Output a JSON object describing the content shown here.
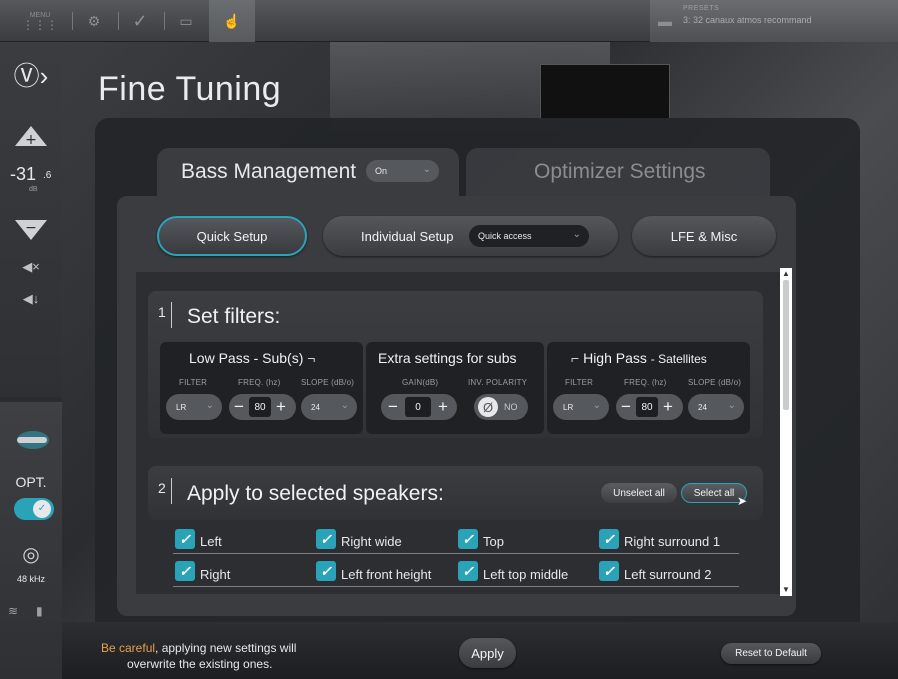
{
  "topbar": {
    "menu_label": "MENU",
    "presets_label": "PRESETS",
    "presets_value": "3: 32 canaux atmos recommand"
  },
  "sidebar": {
    "volume_value": "-31",
    "volume_decimal": ".6",
    "volume_unit": "dB",
    "opt_label": "OPT.",
    "sample_rate": "48 kHz"
  },
  "page": {
    "title": "Fine Tuning"
  },
  "tabs": [
    {
      "label": "Bass Management",
      "combo_value": "On"
    },
    {
      "label": "Optimizer Settings"
    }
  ],
  "subtabs": {
    "quick_setup": "Quick Setup",
    "individual_setup": "Individual Setup",
    "individual_combo": "Quick access",
    "lfe_misc": "LFE & Misc"
  },
  "section1": {
    "number": "1",
    "title": "Set filters:",
    "low_pass": {
      "title": "Low Pass",
      "subtitle": "- Sub(s)",
      "filter_header": "FILTER",
      "freq_header": "FREQ. (hz)",
      "slope_header": "SLOPE (dB/o)",
      "filter_value": "LR",
      "freq_value": "80",
      "slope_value": "24"
    },
    "extra": {
      "title": "Extra settings for subs",
      "gain_header": "GAIN(dB)",
      "polarity_header": "INV. POLARITY",
      "gain_value": "0",
      "polarity_value": "NO",
      "polarity_symbol": "Ø"
    },
    "high_pass": {
      "title": "High Pass",
      "subtitle": "- Satellites",
      "filter_header": "FILTER",
      "freq_header": "FREQ. (hz)",
      "slope_header": "SLOPE (dB/o)",
      "filter_value": "LR",
      "freq_value": "80",
      "slope_value": "24"
    }
  },
  "section2": {
    "number": "2",
    "title": "Apply to selected speakers:",
    "unselect_all": "Unselect all",
    "select_all": "Select all",
    "speakers_row1": [
      "Left",
      "Right wide",
      "Top",
      "Right surround 1"
    ],
    "speakers_row2": [
      "Right",
      "Left front height",
      "Left top middle",
      "Left surround 2"
    ]
  },
  "bottom": {
    "warning_highlight": "Be careful",
    "warning_rest": ", applying new settings will",
    "warning_line2": "overwrite the existing ones.",
    "apply": "Apply",
    "reset": "Reset to Default"
  },
  "colors": {
    "accent": "#2aa3b8",
    "warning": "#e8a04b"
  }
}
